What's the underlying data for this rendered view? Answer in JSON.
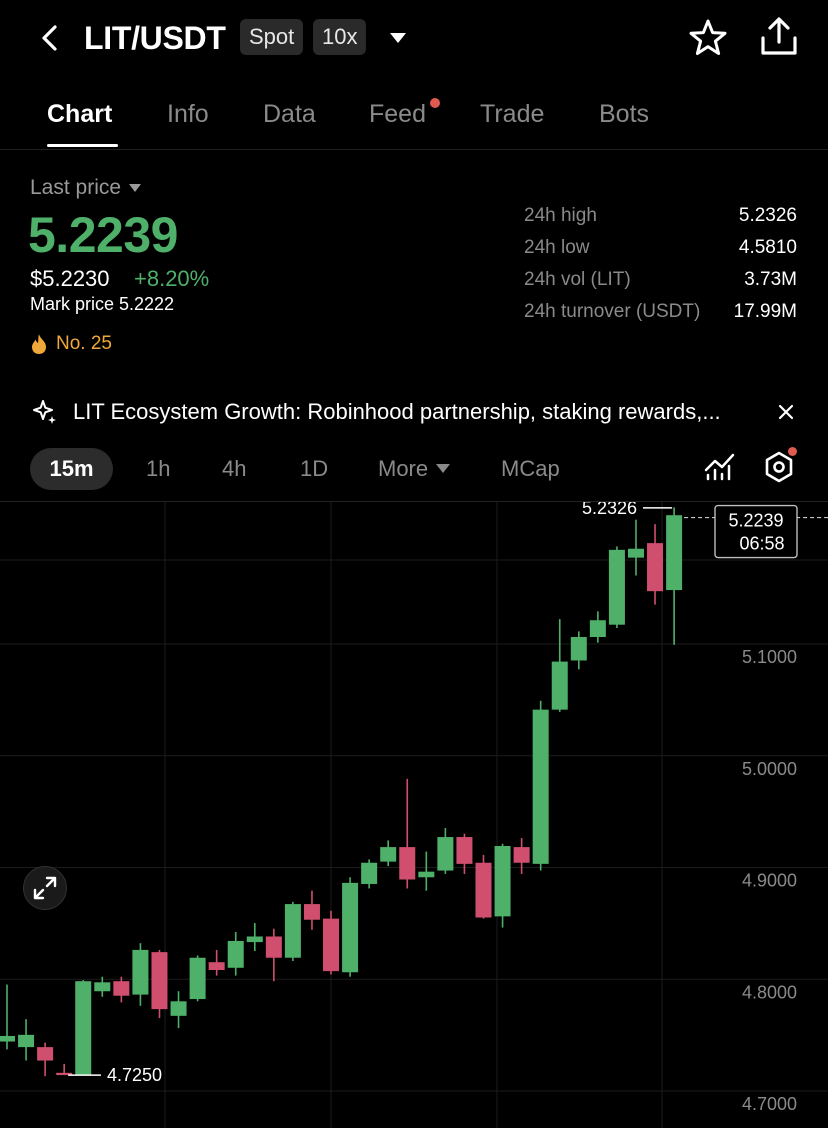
{
  "header": {
    "pair": "LIT/USDT",
    "market_badge": "Spot",
    "leverage_badge": "10x"
  },
  "tabs": [
    {
      "label": "Chart",
      "active": true
    },
    {
      "label": "Info",
      "active": false
    },
    {
      "label": "Data",
      "active": false
    },
    {
      "label": "Feed",
      "active": false,
      "has_notification": true
    },
    {
      "label": "Trade",
      "active": false
    },
    {
      "label": "Bots",
      "active": false
    }
  ],
  "price": {
    "label": "Last price",
    "last": "5.2239",
    "usd": "$5.2230",
    "change_pct": "+8.20%",
    "mark": "Mark price 5.2222",
    "rank": "No. 25"
  },
  "stats": [
    {
      "label": "24h high",
      "value": "5.2326"
    },
    {
      "label": "24h low",
      "value": "4.5810"
    },
    {
      "label": "24h vol (LIT)",
      "value": "3.73M"
    },
    {
      "label": "24h turnover (USDT)",
      "value": "17.99M"
    }
  ],
  "news": {
    "text": "LIT Ecosystem Growth: Robinhood partnership, staking rewards,..."
  },
  "intervals": {
    "active": "15m",
    "items": [
      "1h",
      "4h",
      "1D"
    ],
    "more": "More",
    "mcap": "MCap"
  },
  "colors": {
    "up": "#4fb06a",
    "down": "#d04f6e",
    "accent_orange": "#f0a83a",
    "notification": "#e05a4f"
  },
  "chart_data": {
    "type": "candlestick",
    "y_ticks": [
      "5.1000",
      "5.0000",
      "4.9000",
      "4.8000",
      "4.7000"
    ],
    "ylim": [
      4.69,
      5.245
    ],
    "last_price_tag": {
      "price": "5.2239",
      "countdown": "06:58"
    },
    "high_marker": "5.2326",
    "low_marker": "4.7250",
    "candles": [
      {
        "o": 4.755,
        "c": 4.76,
        "h": 4.806,
        "l": 4.748
      },
      {
        "o": 4.75,
        "c": 4.761,
        "h": 4.775,
        "l": 4.738
      },
      {
        "o": 4.75,
        "c": 4.738,
        "h": 4.754,
        "l": 4.724
      },
      {
        "o": 4.727,
        "c": 4.725,
        "h": 4.735,
        "l": 4.725
      },
      {
        "o": 4.725,
        "c": 4.809,
        "h": 4.81,
        "l": 4.725
      },
      {
        "o": 4.8,
        "c": 4.808,
        "h": 4.813,
        "l": 4.795
      },
      {
        "o": 4.809,
        "c": 4.796,
        "h": 4.813,
        "l": 4.79
      },
      {
        "o": 4.797,
        "c": 4.837,
        "h": 4.843,
        "l": 4.787
      },
      {
        "o": 4.835,
        "c": 4.784,
        "h": 4.837,
        "l": 4.776
      },
      {
        "o": 4.778,
        "c": 4.791,
        "h": 4.8,
        "l": 4.767
      },
      {
        "o": 4.793,
        "c": 4.83,
        "h": 4.832,
        "l": 4.791
      },
      {
        "o": 4.826,
        "c": 4.819,
        "h": 4.837,
        "l": 4.814
      },
      {
        "o": 4.821,
        "c": 4.845,
        "h": 4.853,
        "l": 4.814
      },
      {
        "o": 4.844,
        "c": 4.849,
        "h": 4.861,
        "l": 4.836
      },
      {
        "o": 4.849,
        "c": 4.83,
        "h": 4.856,
        "l": 4.809
      },
      {
        "o": 4.83,
        "c": 4.878,
        "h": 4.88,
        "l": 4.827
      },
      {
        "o": 4.878,
        "c": 4.864,
        "h": 4.89,
        "l": 4.855
      },
      {
        "o": 4.865,
        "c": 4.818,
        "h": 4.872,
        "l": 4.815
      },
      {
        "o": 4.817,
        "c": 4.897,
        "h": 4.902,
        "l": 4.813
      },
      {
        "o": 4.896,
        "c": 4.915,
        "h": 4.918,
        "l": 4.892
      },
      {
        "o": 4.916,
        "c": 4.929,
        "h": 4.935,
        "l": 4.912
      },
      {
        "o": 4.929,
        "c": 4.9,
        "h": 4.99,
        "l": 4.892
      },
      {
        "o": 4.902,
        "c": 4.907,
        "h": 4.925,
        "l": 4.89
      },
      {
        "o": 4.908,
        "c": 4.938,
        "h": 4.946,
        "l": 4.905
      },
      {
        "o": 4.938,
        "c": 4.914,
        "h": 4.941,
        "l": 4.905
      },
      {
        "o": 4.915,
        "c": 4.866,
        "h": 4.922,
        "l": 4.865
      },
      {
        "o": 4.867,
        "c": 4.93,
        "h": 4.932,
        "l": 4.857
      },
      {
        "o": 4.929,
        "c": 4.915,
        "h": 4.937,
        "l": 4.905
      },
      {
        "o": 4.914,
        "c": 5.052,
        "h": 5.06,
        "l": 4.908
      },
      {
        "o": 5.052,
        "c": 5.095,
        "h": 5.133,
        "l": 5.05
      },
      {
        "o": 5.096,
        "c": 5.117,
        "h": 5.122,
        "l": 5.088
      },
      {
        "o": 5.117,
        "c": 5.132,
        "h": 5.14,
        "l": 5.112
      },
      {
        "o": 5.128,
        "c": 5.195,
        "h": 5.198,
        "l": 5.125
      },
      {
        "o": 5.188,
        "c": 5.196,
        "h": 5.222,
        "l": 5.172
      },
      {
        "o": 5.201,
        "c": 5.158,
        "h": 5.218,
        "l": 5.146
      },
      {
        "o": 5.159,
        "c": 5.226,
        "h": 5.233,
        "l": 5.11
      }
    ]
  }
}
